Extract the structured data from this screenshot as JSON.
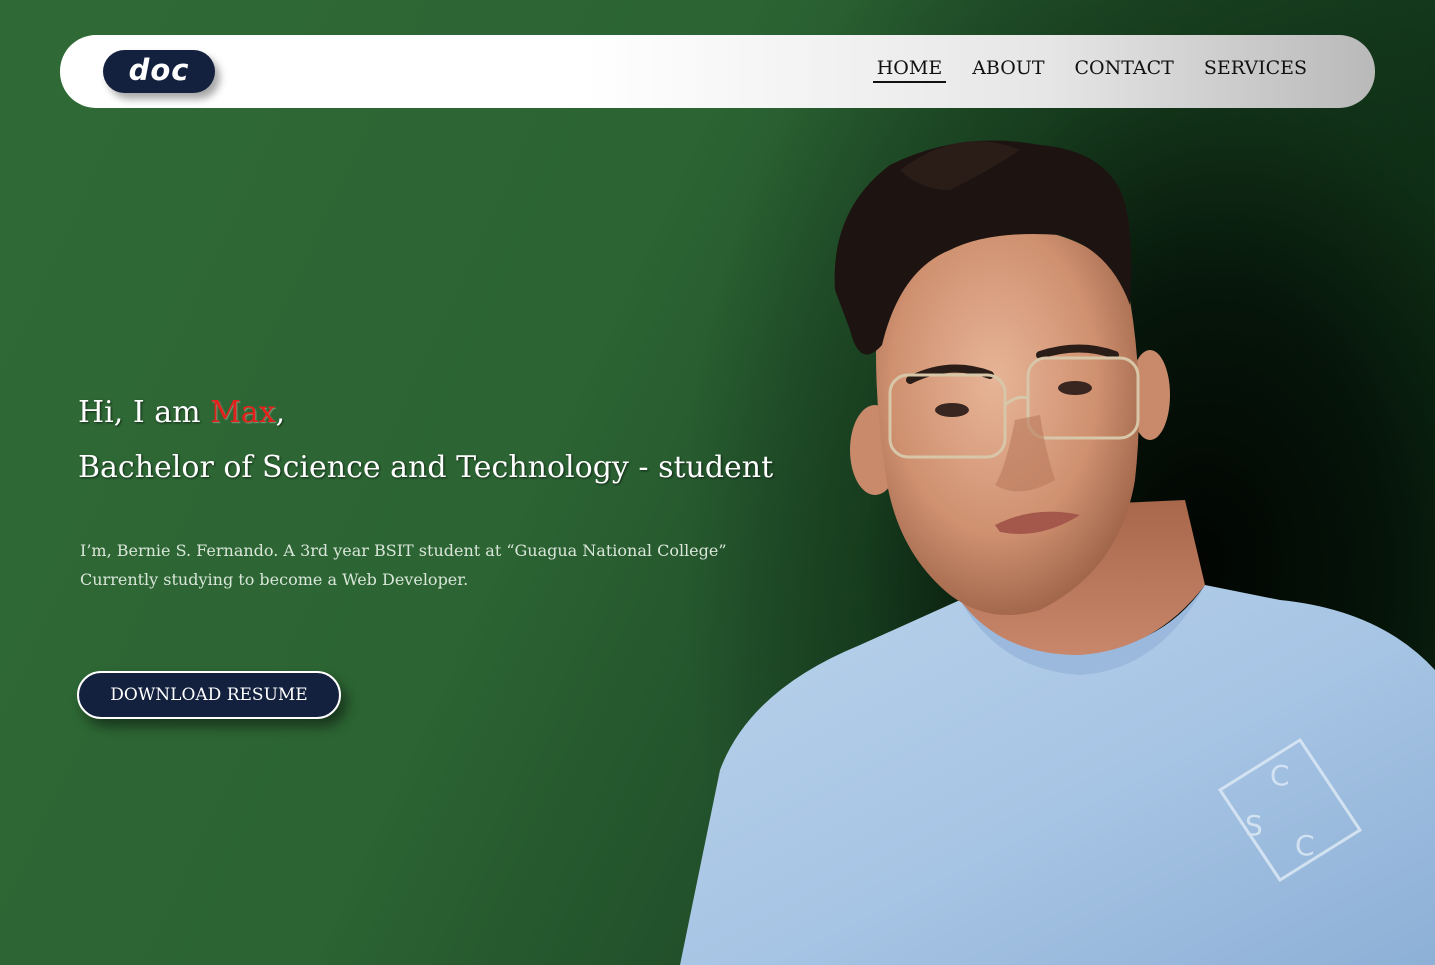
{
  "logo": {
    "text": "doc"
  },
  "nav": {
    "items": [
      {
        "label": "HOME",
        "active": true
      },
      {
        "label": "ABOUT",
        "active": false
      },
      {
        "label": "CONTACT",
        "active": false
      },
      {
        "label": "SERVICES",
        "active": false
      }
    ]
  },
  "hero": {
    "greeting_prefix": "Hi, I am ",
    "name": "Max",
    "greeting_suffix": ",",
    "title": "Bachelor of Science and Technology - student",
    "description_line1": "I’m, Bernie S. Fernando. A 3rd year BSIT student at “Guagua National College”",
    "description_line2": "Currently studying to become a Web Developer.",
    "button_label": "DOWNLOAD RESUME"
  },
  "colors": {
    "background": "#2e6634",
    "navbar": "#ffffff",
    "accent_dark": "#13213f",
    "name_highlight": "#e3201b"
  },
  "icons": {
    "portrait": "person-photo"
  }
}
